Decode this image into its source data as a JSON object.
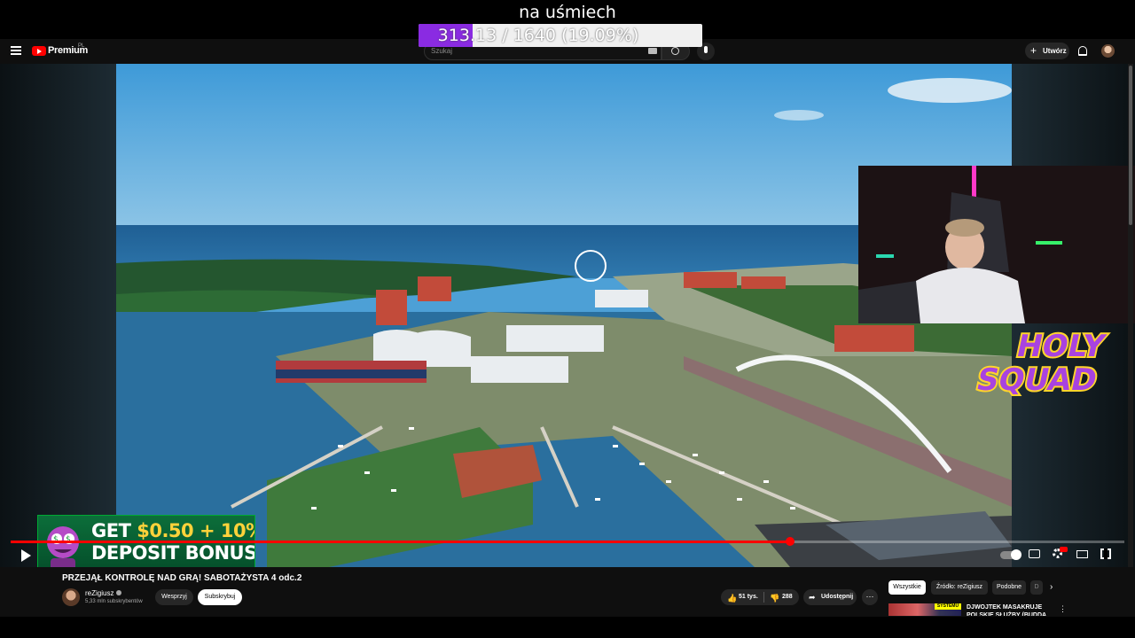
{
  "overlay": {
    "caption": "na uśmiech",
    "goal_text": "313.13 / 1640 (19.09%)",
    "goal_progress": 0.1909,
    "goal_color": "#8a2be2"
  },
  "header": {
    "menu_icon": "hamburger-icon",
    "logo_text": "Premium",
    "logo_region": "PL",
    "search_placeholder": "Szukaj",
    "create_label": "Utwórz",
    "icons": [
      "keyboard-icon",
      "search-icon",
      "microphone-icon",
      "bell-icon",
      "avatar"
    ]
  },
  "video": {
    "progress": 0.7,
    "accent_color": "#ff0000",
    "ad": {
      "line1_prefix": "GET ",
      "line1_amount": "$0.50",
      "line1_suffix": " + 10%",
      "line2": "DEPOSIT BONUS"
    },
    "overlay_logo_line1": "HOLY",
    "overlay_logo_line2": "SQUAD"
  },
  "details": {
    "title": "PRZEJĄŁ KONTROLĘ NAD GRĄ! SABOTAŻYSTA 4 odc.2",
    "channel_name": "reZigiusz",
    "subscribers": "5,33 mln subskrybentów",
    "support_label": "Wesprzyj",
    "subscribe_label": "Subskrybuj",
    "likes": "51 tys.",
    "dislikes": "288",
    "share_label": "Udostępnij",
    "more_label": "⋯"
  },
  "sidebar": {
    "chips": [
      "Wszystkie",
      "Źródło: reZigiusz",
      "Podobne",
      "D"
    ],
    "recommendation": {
      "badge": "SYSTEMU",
      "title": "DJWOJTEK MASAKRUJE POLSKIE SŁUŻBY (BUDDA"
    }
  }
}
